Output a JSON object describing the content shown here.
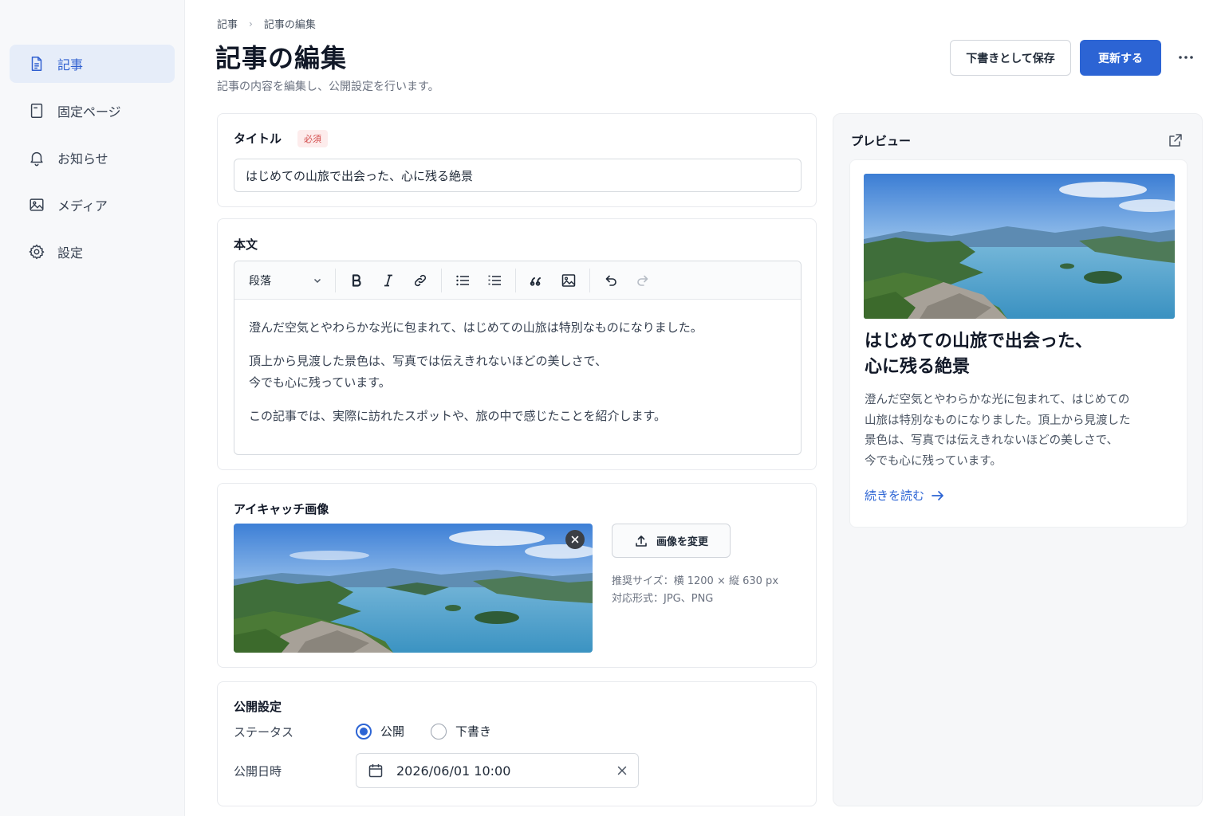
{
  "sidebar": {
    "items": [
      {
        "label": "記事",
        "icon": "document-icon"
      },
      {
        "label": "固定ページ",
        "icon": "page-icon"
      },
      {
        "label": "お知らせ",
        "icon": "bell-icon"
      },
      {
        "label": "メディア",
        "icon": "image-icon"
      },
      {
        "label": "設定",
        "icon": "gear-icon"
      }
    ]
  },
  "header": {
    "breadcrumb": [
      "記事",
      "記事の編集"
    ],
    "title": "記事の編集",
    "subtitle": "記事の内容を編集し、公開設定を行います。",
    "save_draft_label": "下書きとして保存",
    "update_label": "更新する"
  },
  "title_section": {
    "label": "タイトル",
    "required_badge": "必須",
    "value": "はじめての山旅で出会った、心に残る絶景"
  },
  "body_section": {
    "label": "本文",
    "format_select": "段落",
    "paragraphs": [
      "澄んだ空気とやわらかな光に包まれて、はじめての山旅は特別なものになりました。",
      "頂上から見渡した景色は、写真では伝えきれないほどの美しさで、",
      "今でも心に残っています。",
      "この記事では、実際に訪れたスポットや、旅の中で感じたことを紹介します。"
    ]
  },
  "featured_image": {
    "label": "アイキャッチ画像",
    "change_label": "画像を変更",
    "recommended_size": "推奨サイズ：横 1200 × 縦 630 px",
    "formats": "対応形式：JPG、PNG"
  },
  "publish": {
    "label": "公開設定",
    "status_label": "ステータス",
    "status_options": [
      "公開",
      "下書き"
    ],
    "selected": "公開",
    "date_label": "公開日時",
    "date_value": "2026/06/01 10:00"
  },
  "preview": {
    "title": "プレビュー",
    "heading_line1": "はじめての山旅で出会った、",
    "heading_line2": "心に残る絶景",
    "excerpt_lines": [
      "澄んだ空気とやわらかな光に包まれて、はじめての",
      "山旅は特別なものになりました。頂上から見渡した",
      "景色は、写真では伝えきれないほどの美しさで、",
      "今でも心に残っています。"
    ],
    "read_more": "続きを読む"
  },
  "colors": {
    "accent": "#2c64d4",
    "required": "#d24a4a",
    "sidebar_active_bg": "#e6edf9"
  }
}
